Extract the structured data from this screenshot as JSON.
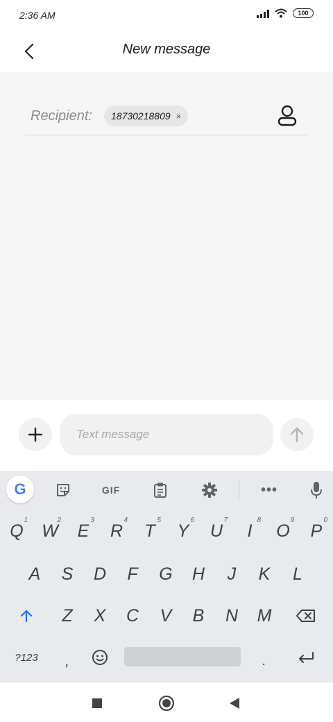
{
  "status_bar": {
    "time": "2:36 AM",
    "battery": "100"
  },
  "header": {
    "title": "New message"
  },
  "recipient": {
    "label": "Recipient:",
    "chip_value": "18730218809",
    "chip_close": "×"
  },
  "compose": {
    "placeholder": "Text message"
  },
  "keyboard": {
    "toolbar": {
      "google": "G",
      "gif": "GIF",
      "more": "•••"
    },
    "row1": [
      {
        "key": "Q",
        "hint": "1"
      },
      {
        "key": "W",
        "hint": "2"
      },
      {
        "key": "E",
        "hint": "3"
      },
      {
        "key": "R",
        "hint": "4"
      },
      {
        "key": "T",
        "hint": "5"
      },
      {
        "key": "Y",
        "hint": "6"
      },
      {
        "key": "U",
        "hint": "7"
      },
      {
        "key": "I",
        "hint": "8"
      },
      {
        "key": "O",
        "hint": "9"
      },
      {
        "key": "P",
        "hint": "0"
      }
    ],
    "row2": [
      "A",
      "S",
      "D",
      "F",
      "G",
      "H",
      "J",
      "K",
      "L"
    ],
    "row3": [
      "Z",
      "X",
      "C",
      "V",
      "B",
      "N",
      "M"
    ],
    "row4": {
      "symbols": "?123",
      "comma": ",",
      "period": "."
    }
  },
  "colors": {
    "accent": "#1a73e8",
    "panel": "#f6f6f6",
    "keyboard": "#e8eaed"
  }
}
